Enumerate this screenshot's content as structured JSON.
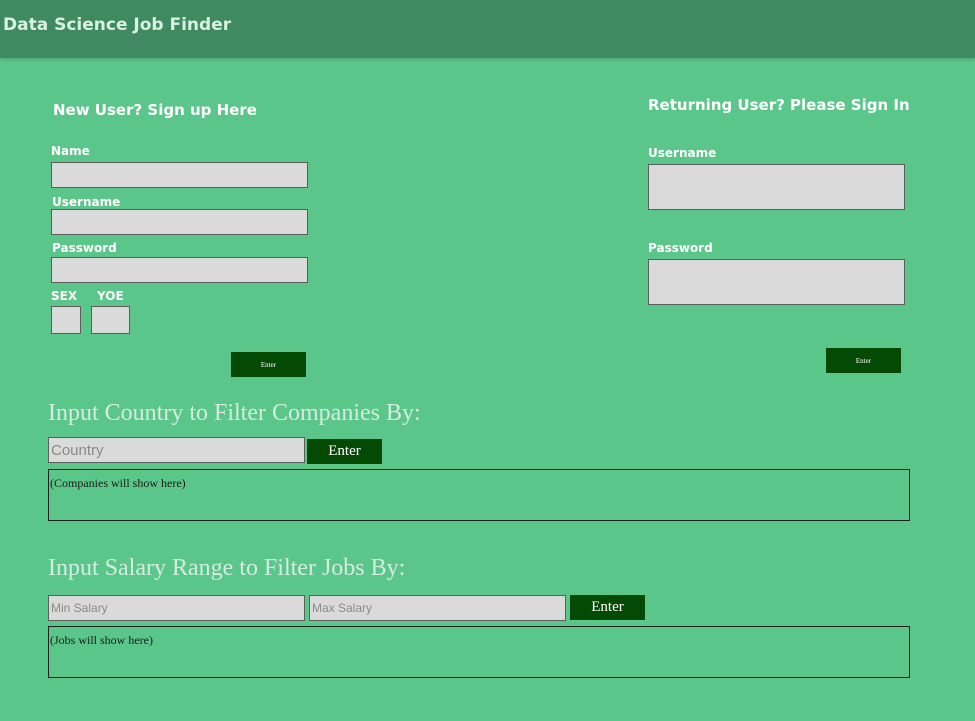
{
  "header": {
    "title": "Data Science Job Finder"
  },
  "signup": {
    "heading": "New User? Sign up Here",
    "name_label": "Name",
    "username_label": "Username",
    "password_label": "Password",
    "sex_label": "SEX",
    "yoe_label": "YOE",
    "button_label": "Enter"
  },
  "signin": {
    "heading": "Returning User? Please Sign In",
    "username_label": "Username",
    "password_label": "Password",
    "button_label": "Enter"
  },
  "company_filter": {
    "heading": "Input Country to Filter Companies By:",
    "country_placeholder": "Country",
    "button_label": "Enter",
    "results_text": "(Companies will show here)"
  },
  "salary_filter": {
    "heading": "Input Salary Range to Filter Jobs By:",
    "min_placeholder": "Min Salary",
    "max_placeholder": "Max Salary",
    "button_label": "Enter",
    "results_text": "(Jobs will show here)"
  },
  "colors": {
    "background": "#5bc68a",
    "header": "#3f8a60",
    "button": "#044a05",
    "input": "#dadada"
  }
}
